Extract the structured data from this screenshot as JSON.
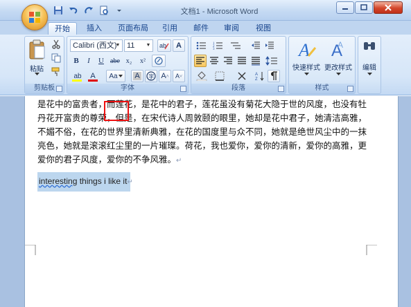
{
  "window": {
    "title": "文档1 - Microsoft Word"
  },
  "tabs": [
    "开始",
    "插入",
    "页面布局",
    "引用",
    "邮件",
    "审阅",
    "视图"
  ],
  "clipboard": {
    "paste_label": "粘贴",
    "group_label": "剪贴板"
  },
  "font": {
    "name_value": "Calibri (西文)",
    "size_value": "11",
    "bold": "B",
    "italic": "I",
    "underline": "U",
    "strike": "abe",
    "subscript": "x₂",
    "superscript": "x²",
    "change_case": "Aa",
    "grow": "A",
    "shrink": "A",
    "char_border": "A",
    "char_shading": "字",
    "font_color": "A",
    "highlight": "ab",
    "group_label": "字体"
  },
  "paragraph": {
    "group_label": "段落"
  },
  "styles": {
    "quick_styles_label": "快速样式",
    "change_styles_label": "更改样式",
    "group_label": "样式"
  },
  "editing": {
    "label": "编辑"
  },
  "document": {
    "lines": [
      "是花中的富贵者，而莲花，是花中的君子，莲花虽没有菊花大隐于世的风度，也没有牡",
      "丹花开富贵的尊荣，但是，在宋代诗人周敦颐的眼里，她却是花中君子，她清洁高雅，",
      "不媚不俗，在花的世界里清新典雅，在花的国度里与众不同，她就是绝世风尘中的一抹",
      "亮色，她就是滚滚红尘里的一片璀璨。荷花，我也爱你，爱你的清新，爱你的高雅，更",
      "爱你的君子风度，爱你的不争风雅。"
    ],
    "selected_word": "interesting",
    "selected_rest": " things i like it"
  },
  "colors": {
    "ribbon_bg": "#dbe8f8",
    "font_color_bar": "#e00000",
    "highlight_bar": "#ffff00",
    "selection": "#bcd6ee",
    "annotation_box": "#ee1111"
  }
}
